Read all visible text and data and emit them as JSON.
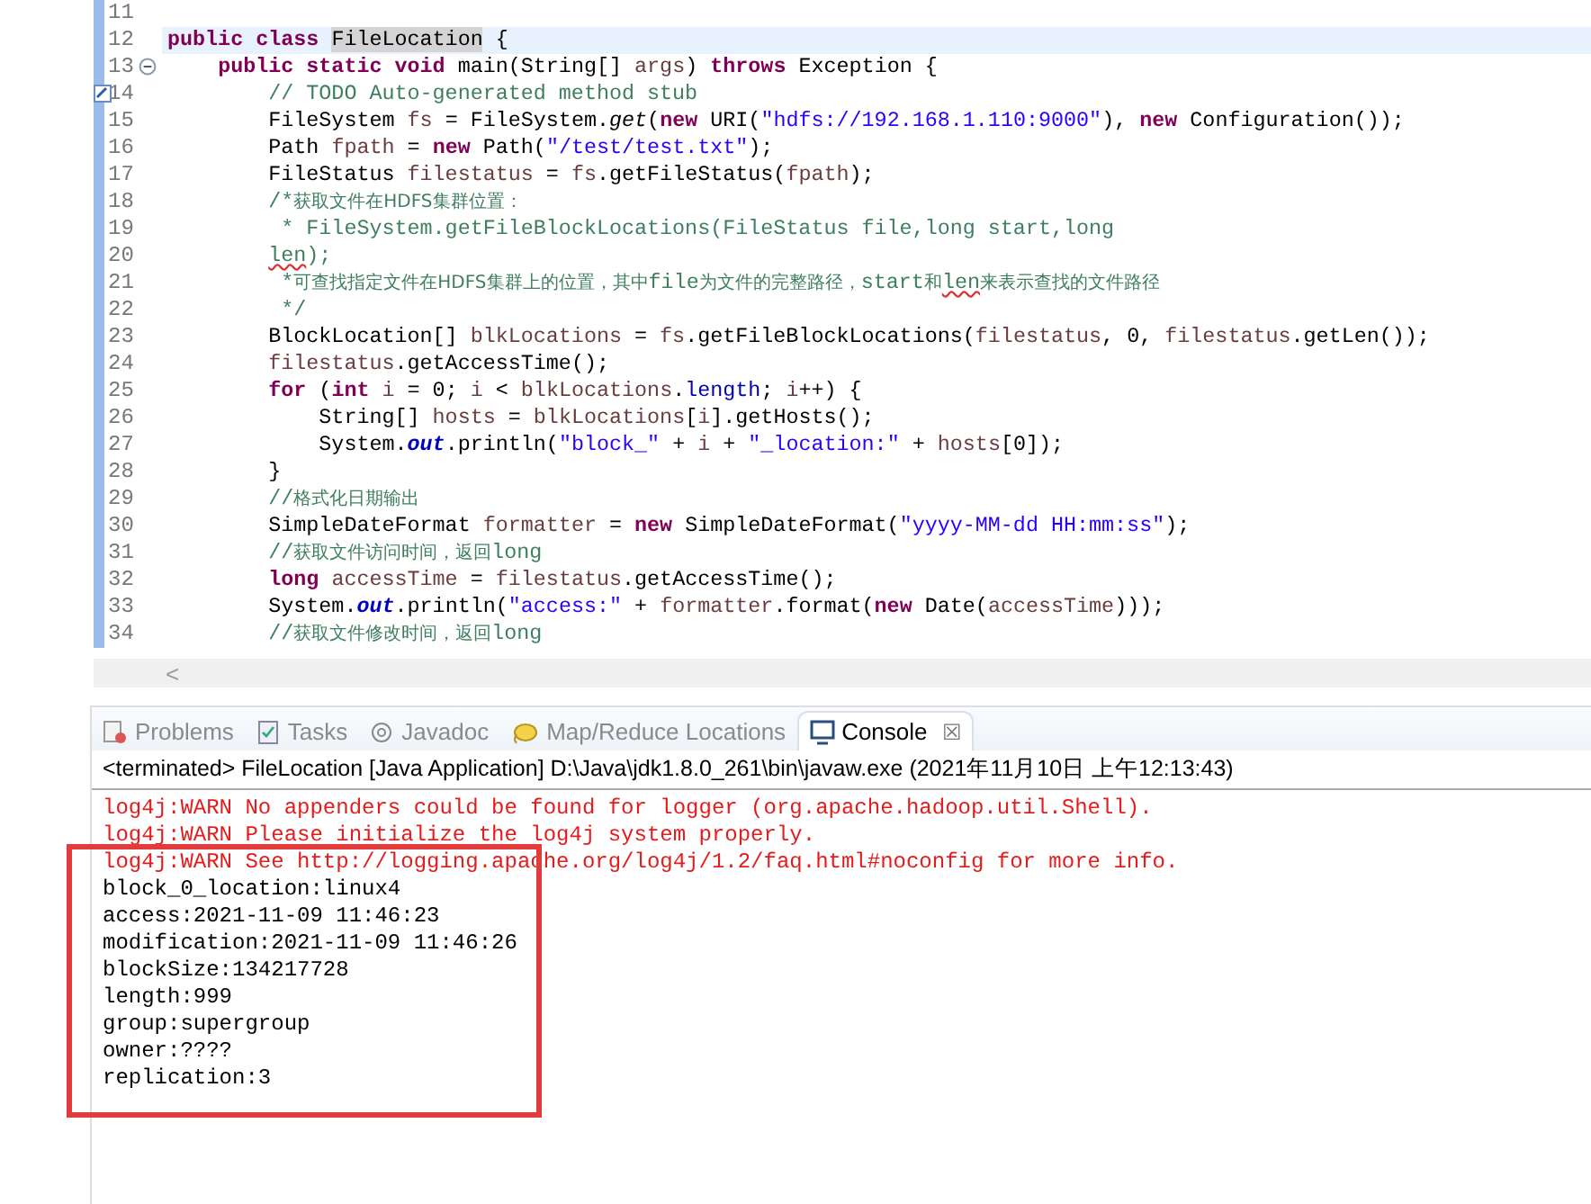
{
  "editor": {
    "lines": [
      {
        "number": "11",
        "current": false
      },
      {
        "number": "12",
        "current": true,
        "segments": [
          {
            "kind": "k",
            "text": "public class"
          },
          {
            "kind": "h",
            "text": " FileLocation"
          },
          {
            "kind": "t",
            "text": " {"
          }
        ]
      },
      {
        "number": "13",
        "current": false,
        "kind": "fold",
        "segments": [
          {
            "kind": "k",
            "text": "    public static void"
          },
          {
            "kind": "t",
            "text": " main(String[] "
          },
          {
            "kind": "v",
            "text": "args"
          },
          {
            "kind": "t",
            "text": ") "
          },
          {
            "kind": "k",
            "text": "throws"
          },
          {
            "kind": "t",
            "text": " Exception {"
          }
        ]
      },
      {
        "number": "14",
        "current": false,
        "kind": "task",
        "segments": [
          {
            "kind": "c",
            "text": "        // TODO Auto-generated method stub"
          }
        ]
      },
      {
        "number": "15",
        "current": false,
        "segments": [
          {
            "kind": "t",
            "text": "        FileSystem "
          },
          {
            "kind": "v",
            "text": "fs"
          },
          {
            "kind": "t",
            "text": " = FileSystem."
          },
          {
            "kind": "m",
            "text": "get"
          },
          {
            "kind": "t",
            "text": "("
          },
          {
            "kind": "k",
            "text": "new"
          },
          {
            "kind": "t",
            "text": " URI("
          },
          {
            "kind": "s",
            "text": "\"hdfs://192.168.1.110:9000\""
          },
          {
            "kind": "t",
            "text": "), "
          },
          {
            "kind": "k",
            "text": "new"
          },
          {
            "kind": "t",
            "text": " Configuration());"
          }
        ]
      },
      {
        "number": "16",
        "current": false,
        "segments": [
          {
            "kind": "t",
            "text": "        Path "
          },
          {
            "kind": "v",
            "text": "fpath"
          },
          {
            "kind": "t",
            "text": " = "
          },
          {
            "kind": "k",
            "text": "new"
          },
          {
            "kind": "t",
            "text": " Path("
          },
          {
            "kind": "s",
            "text": "\"/test/test.txt\""
          },
          {
            "kind": "t",
            "text": ");"
          }
        ]
      },
      {
        "number": "17",
        "current": false,
        "segments": [
          {
            "kind": "t",
            "text": "        FileStatus "
          },
          {
            "kind": "v",
            "text": "filestatus"
          },
          {
            "kind": "t",
            "text": " = "
          },
          {
            "kind": "v",
            "text": "fs"
          },
          {
            "kind": "t",
            "text": ".getFileStatus("
          },
          {
            "kind": "v",
            "text": "fpath"
          },
          {
            "kind": "t",
            "text": ");"
          }
        ]
      },
      {
        "number": "18",
        "current": false,
        "segments": [
          {
            "kind": "c",
            "text": "        /*"
          },
          {
            "kind": "z",
            "text": "获取文件在HDFS集群位置："
          }
        ]
      },
      {
        "number": "19",
        "current": false,
        "segments": [
          {
            "kind": "c",
            "text": "         * FileSystem.getFileBlockLocations(FileStatus file,long start,long"
          }
        ]
      },
      {
        "number": "20",
        "current": false,
        "segments": [
          {
            "kind": "w",
            "text": "        len"
          },
          {
            "kind": "c",
            "text": ");"
          }
        ]
      },
      {
        "number": "21",
        "current": false,
        "segments": [
          {
            "kind": "c",
            "text": "         *"
          },
          {
            "kind": "z",
            "text": "可查找指定文件在HDFS集群上的位置，其中"
          },
          {
            "kind": "c",
            "text": "file"
          },
          {
            "kind": "z",
            "text": "为文件的完整路径，"
          },
          {
            "kind": "c",
            "text": "start"
          },
          {
            "kind": "z",
            "text": "和"
          },
          {
            "kind": "w",
            "text": "len"
          },
          {
            "kind": "z",
            "text": "来表示查找的文件路径"
          }
        ]
      },
      {
        "number": "22",
        "current": false,
        "segments": [
          {
            "kind": "c",
            "text": "         */"
          }
        ]
      },
      {
        "number": "23",
        "current": false,
        "segments": [
          {
            "kind": "t",
            "text": "        BlockLocation[] "
          },
          {
            "kind": "v",
            "text": "blkLocations"
          },
          {
            "kind": "t",
            "text": " = "
          },
          {
            "kind": "v",
            "text": "fs"
          },
          {
            "kind": "t",
            "text": ".getFileBlockLocations("
          },
          {
            "kind": "v",
            "text": "filestatus"
          },
          {
            "kind": "t",
            "text": ", 0, "
          },
          {
            "kind": "v",
            "text": "filestatus"
          },
          {
            "kind": "t",
            "text": ".getLen());"
          }
        ]
      },
      {
        "number": "24",
        "current": false,
        "segments": [
          {
            "kind": "v",
            "text": "        filestatus"
          },
          {
            "kind": "t",
            "text": ".getAccessTime();"
          }
        ]
      },
      {
        "number": "25",
        "current": false,
        "segments": [
          {
            "kind": "k",
            "text": "        for"
          },
          {
            "kind": "t",
            "text": " ("
          },
          {
            "kind": "k",
            "text": "int"
          },
          {
            "kind": "v",
            "text": " i"
          },
          {
            "kind": "t",
            "text": " = 0; "
          },
          {
            "kind": "v",
            "text": "i"
          },
          {
            "kind": "t",
            "text": " < "
          },
          {
            "kind": "v",
            "text": "blkLocations"
          },
          {
            "kind": "t",
            "text": "."
          },
          {
            "kind": "l",
            "text": "length"
          },
          {
            "kind": "t",
            "text": "; "
          },
          {
            "kind": "v",
            "text": "i"
          },
          {
            "kind": "t",
            "text": "++) {"
          }
        ]
      },
      {
        "number": "26",
        "current": false,
        "segments": [
          {
            "kind": "t",
            "text": "            String[] "
          },
          {
            "kind": "v",
            "text": "hosts"
          },
          {
            "kind": "t",
            "text": " = "
          },
          {
            "kind": "v",
            "text": "blkLocations"
          },
          {
            "kind": "t",
            "text": "["
          },
          {
            "kind": "v",
            "text": "i"
          },
          {
            "kind": "t",
            "text": "].getHosts();"
          }
        ]
      },
      {
        "number": "27",
        "current": false,
        "segments": [
          {
            "kind": "t",
            "text": "            System."
          },
          {
            "kind": "f",
            "text": "out"
          },
          {
            "kind": "t",
            "text": ".println("
          },
          {
            "kind": "s",
            "text": "\"block_\""
          },
          {
            "kind": "t",
            "text": " + "
          },
          {
            "kind": "v",
            "text": "i"
          },
          {
            "kind": "t",
            "text": " + "
          },
          {
            "kind": "s",
            "text": "\"_location:\""
          },
          {
            "kind": "t",
            "text": " + "
          },
          {
            "kind": "v",
            "text": "hosts"
          },
          {
            "kind": "t",
            "text": "[0]);"
          }
        ]
      },
      {
        "number": "28",
        "current": false,
        "segments": [
          {
            "kind": "t",
            "text": "        }"
          }
        ]
      },
      {
        "number": "29",
        "current": false,
        "segments": [
          {
            "kind": "c",
            "text": "        //"
          },
          {
            "kind": "z",
            "text": "格式化日期输出"
          }
        ]
      },
      {
        "number": "30",
        "current": false,
        "segments": [
          {
            "kind": "t",
            "text": "        SimpleDateFormat "
          },
          {
            "kind": "v",
            "text": "formatter"
          },
          {
            "kind": "t",
            "text": " = "
          },
          {
            "kind": "k",
            "text": "new"
          },
          {
            "kind": "t",
            "text": " SimpleDateFormat("
          },
          {
            "kind": "s",
            "text": "\"yyyy-MM-dd HH:mm:ss\""
          },
          {
            "kind": "t",
            "text": ");"
          }
        ]
      },
      {
        "number": "31",
        "current": false,
        "segments": [
          {
            "kind": "c",
            "text": "        //"
          },
          {
            "kind": "z",
            "text": "获取文件访问时间，返回"
          },
          {
            "kind": "c",
            "text": "long"
          }
        ]
      },
      {
        "number": "32",
        "current": false,
        "segments": [
          {
            "kind": "k",
            "text": "        long"
          },
          {
            "kind": "v",
            "text": " accessTime"
          },
          {
            "kind": "t",
            "text": " = "
          },
          {
            "kind": "v",
            "text": "filestatus"
          },
          {
            "kind": "t",
            "text": ".getAccessTime();"
          }
        ]
      },
      {
        "number": "33",
        "current": false,
        "segments": [
          {
            "kind": "t",
            "text": "        System."
          },
          {
            "kind": "f",
            "text": "out"
          },
          {
            "kind": "t",
            "text": ".println("
          },
          {
            "kind": "s",
            "text": "\"access:\""
          },
          {
            "kind": "t",
            "text": " + "
          },
          {
            "kind": "v",
            "text": "formatter"
          },
          {
            "kind": "t",
            "text": ".format("
          },
          {
            "kind": "k",
            "text": "new"
          },
          {
            "kind": "t",
            "text": " Date("
          },
          {
            "kind": "v",
            "text": "accessTime"
          },
          {
            "kind": "t",
            "text": ")));"
          }
        ]
      },
      {
        "number": "34",
        "current": false,
        "segments": [
          {
            "kind": "c",
            "text": "        //"
          },
          {
            "kind": "z",
            "text": "获取文件修改时间，返回"
          },
          {
            "kind": "c",
            "text": "long"
          }
        ]
      }
    ]
  },
  "tabs": [
    {
      "label": "Problems",
      "selected": false
    },
    {
      "label": "Tasks",
      "selected": false
    },
    {
      "label": "Javadoc",
      "selected": false
    },
    {
      "label": "Map/Reduce Locations",
      "selected": false
    },
    {
      "label": "Console",
      "selected": true,
      "close": "☒"
    }
  ],
  "console": {
    "status": "<terminated> FileLocation [Java Application] D:\\Java\\jdk1.8.0_261\\bin\\javaw.exe (2021年11月10日 上午12:13:43)",
    "lines": [
      {
        "kind": "error",
        "text": "log4j:WARN No appenders could be found for logger (org.apache.hadoop.util.Shell)."
      },
      {
        "kind": "error",
        "text": "log4j:WARN Please initialize the log4j system properly."
      },
      {
        "kind": "error",
        "text": "log4j:WARN See http://logging.apache.org/log4j/1.2/faq.html#noconfig for more info."
      },
      {
        "kind": "output",
        "text": "block_0_location:linux4"
      },
      {
        "kind": "output",
        "text": "access:2021-11-09 11:46:23"
      },
      {
        "kind": "output",
        "text": "modification:2021-11-09 11:46:26"
      },
      {
        "kind": "output",
        "text": "blockSize:134217728"
      },
      {
        "kind": "output",
        "text": "length:999"
      },
      {
        "kind": "output",
        "text": "group:supergroup"
      },
      {
        "kind": "output",
        "text": "owner:????"
      },
      {
        "kind": "output",
        "text": "replication:3"
      }
    ]
  },
  "scrollbar": {
    "arrow": "<"
  }
}
